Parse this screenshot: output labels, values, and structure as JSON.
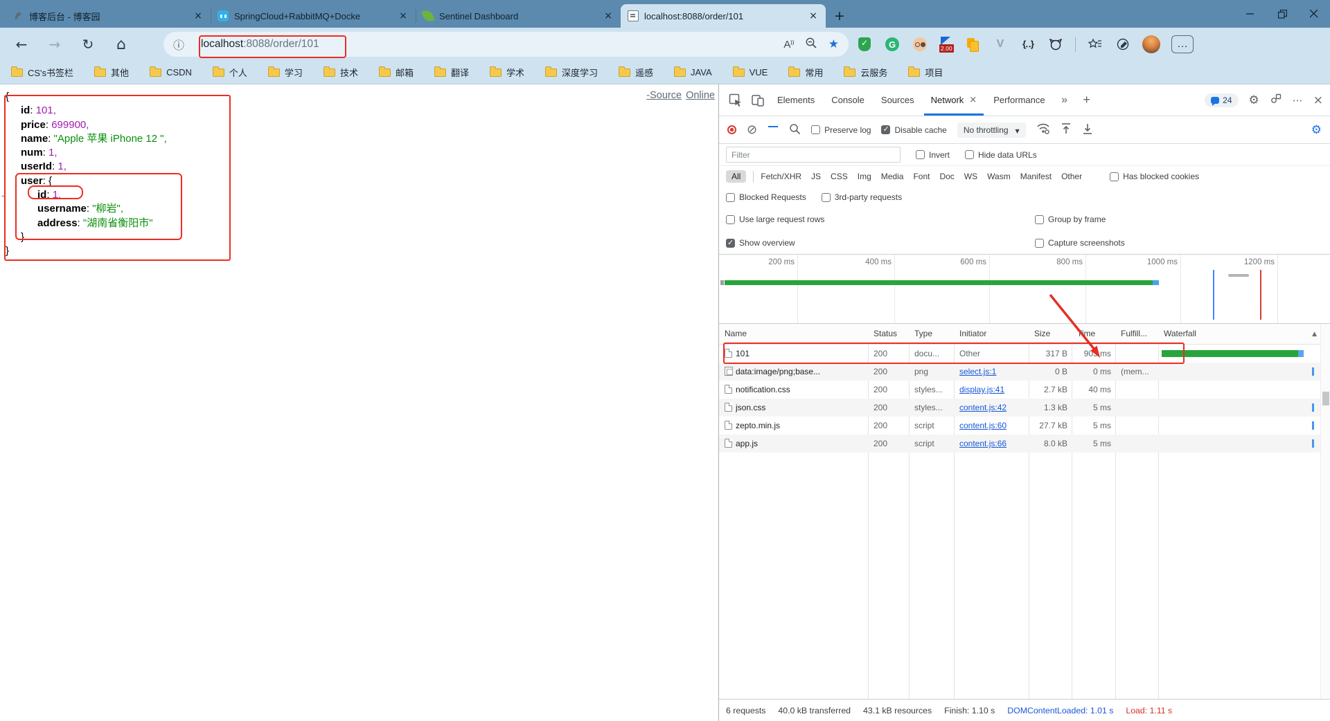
{
  "tabs": {
    "items": [
      {
        "title": "博客后台 - 博客园"
      },
      {
        "title": "SpringCloud+RabbitMQ+Docke"
      },
      {
        "title": "Sentinel Dashboard"
      },
      {
        "title": "localhost:8088/order/101"
      }
    ]
  },
  "toolbar": {
    "url_host": "localhost",
    "url_rest": ":8088/order/101",
    "flag_badge": "2.00"
  },
  "bookmarks": {
    "items": [
      "CS's书签栏",
      "其他",
      "CSDN",
      "个人",
      "学习",
      "技术",
      "邮箱",
      "翻译",
      "学术",
      "深度学习",
      "遥感",
      "JAVA",
      "VUE",
      "常用",
      "云服务",
      "项目"
    ]
  },
  "page": {
    "source_link": "-Source",
    "online_link": "Online",
    "json": {
      "open": "{",
      "close": "}",
      "inner_close": "}",
      "lines": [
        {
          "key": "id",
          "value": "101,"
        },
        {
          "key": "price",
          "value": "699900,"
        },
        {
          "key": "name",
          "value": "\"Apple 苹果 iPhone 12 \","
        },
        {
          "key": "num",
          "value": "1,"
        },
        {
          "key": "userId",
          "value": "1,"
        },
        {
          "key": "user",
          "value": "{"
        },
        {
          "key": "id",
          "value": "1,"
        },
        {
          "key": "username",
          "value": "\"柳岩\","
        },
        {
          "key": "address",
          "value": "\"湖南省衡阳市\""
        }
      ]
    }
  },
  "devtools": {
    "tabs": [
      "Elements",
      "Console",
      "Sources",
      "Network",
      "Performance"
    ],
    "issues_count": "24",
    "net": {
      "preserve_log": "Preserve log",
      "disable_cache": "Disable cache",
      "throttling": "No throttling",
      "filter_placeholder": "Filter",
      "invert": "Invert",
      "hide_data_urls": "Hide data URLs",
      "pills": [
        "All",
        "Fetch/XHR",
        "JS",
        "CSS",
        "Img",
        "Media",
        "Font",
        "Doc",
        "WS",
        "Wasm",
        "Manifest",
        "Other"
      ],
      "has_blocked_cookies": "Has blocked cookies",
      "blocked_requests": "Blocked Requests",
      "third_party": "3rd-party requests",
      "use_large_rows": "Use large request rows",
      "group_by_frame": "Group by frame",
      "show_overview": "Show overview",
      "capture_screenshots": "Capture screenshots"
    },
    "timeline": {
      "ticks": [
        "200 ms",
        "400 ms",
        "600 ms",
        "800 ms",
        "1000 ms",
        "1200 ms"
      ]
    },
    "table": {
      "columns": [
        "Name",
        "Status",
        "Type",
        "Initiator",
        "Size",
        "Time",
        "Fulfill...",
        "Waterfall"
      ],
      "rows": [
        {
          "name": "101",
          "status": "200",
          "type": "docu...",
          "initiator": "Other",
          "size": "317 B",
          "time": "903 ms",
          "fulfilled": ""
        },
        {
          "name": "data:image/png;base...",
          "status": "200",
          "type": "png",
          "initiator": "select.js:1",
          "size": "0 B",
          "time": "0 ms",
          "fulfilled": "(mem..."
        },
        {
          "name": "notification.css",
          "status": "200",
          "type": "styles...",
          "initiator": "display.js:41",
          "size": "2.7 kB",
          "time": "40 ms",
          "fulfilled": ""
        },
        {
          "name": "json.css",
          "status": "200",
          "type": "styles...",
          "initiator": "content.js:42",
          "size": "1.3 kB",
          "time": "5 ms",
          "fulfilled": ""
        },
        {
          "name": "zepto.min.js",
          "status": "200",
          "type": "script",
          "initiator": "content.js:60",
          "size": "27.7 kB",
          "time": "5 ms",
          "fulfilled": ""
        },
        {
          "name": "app.js",
          "status": "200",
          "type": "script",
          "initiator": "content.js:66",
          "size": "8.0 kB",
          "time": "5 ms",
          "fulfilled": ""
        }
      ]
    },
    "footer": {
      "requests": "6 requests",
      "transferred": "40.0 kB transferred",
      "resources": "43.1 kB resources",
      "finish": "Finish: 1.10 s",
      "dcl": "DOMContentLoaded: 1.01 s",
      "load": "Load: 1.11 s"
    }
  }
}
